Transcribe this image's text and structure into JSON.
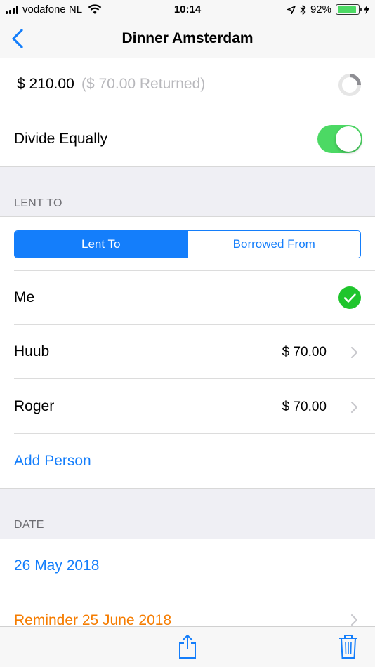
{
  "status_bar": {
    "carrier": "vodafone NL",
    "time": "10:14",
    "battery": "92%"
  },
  "nav": {
    "title": "Dinner Amsterdam"
  },
  "summary": {
    "total": "$ 210.00",
    "returned": "($ 70.00 Returned)"
  },
  "divide": {
    "label": "Divide Equally",
    "enabled": true
  },
  "lent_section": {
    "header": "LENT TO",
    "segments": [
      "Lent To",
      "Borrowed From"
    ],
    "selected": "Lent To"
  },
  "people": [
    {
      "name": "Me",
      "amount": "",
      "checked": true
    },
    {
      "name": "Huub",
      "amount": "$ 70.00"
    },
    {
      "name": "Roger",
      "amount": "$ 70.00"
    }
  ],
  "add_person": "Add Person",
  "date_section": {
    "header": "DATE",
    "date": "26 May 2018",
    "reminder": "Reminder 25 June 2018"
  },
  "colors": {
    "accent": "#147efb",
    "toggle_on": "#4cd964",
    "check": "#1fc52c",
    "reminder": "#f57c00"
  },
  "icons": [
    "back-chevron-icon",
    "progress-ring-icon",
    "checkmark-icon",
    "chevron-right-icon",
    "share-icon",
    "trash-icon"
  ]
}
